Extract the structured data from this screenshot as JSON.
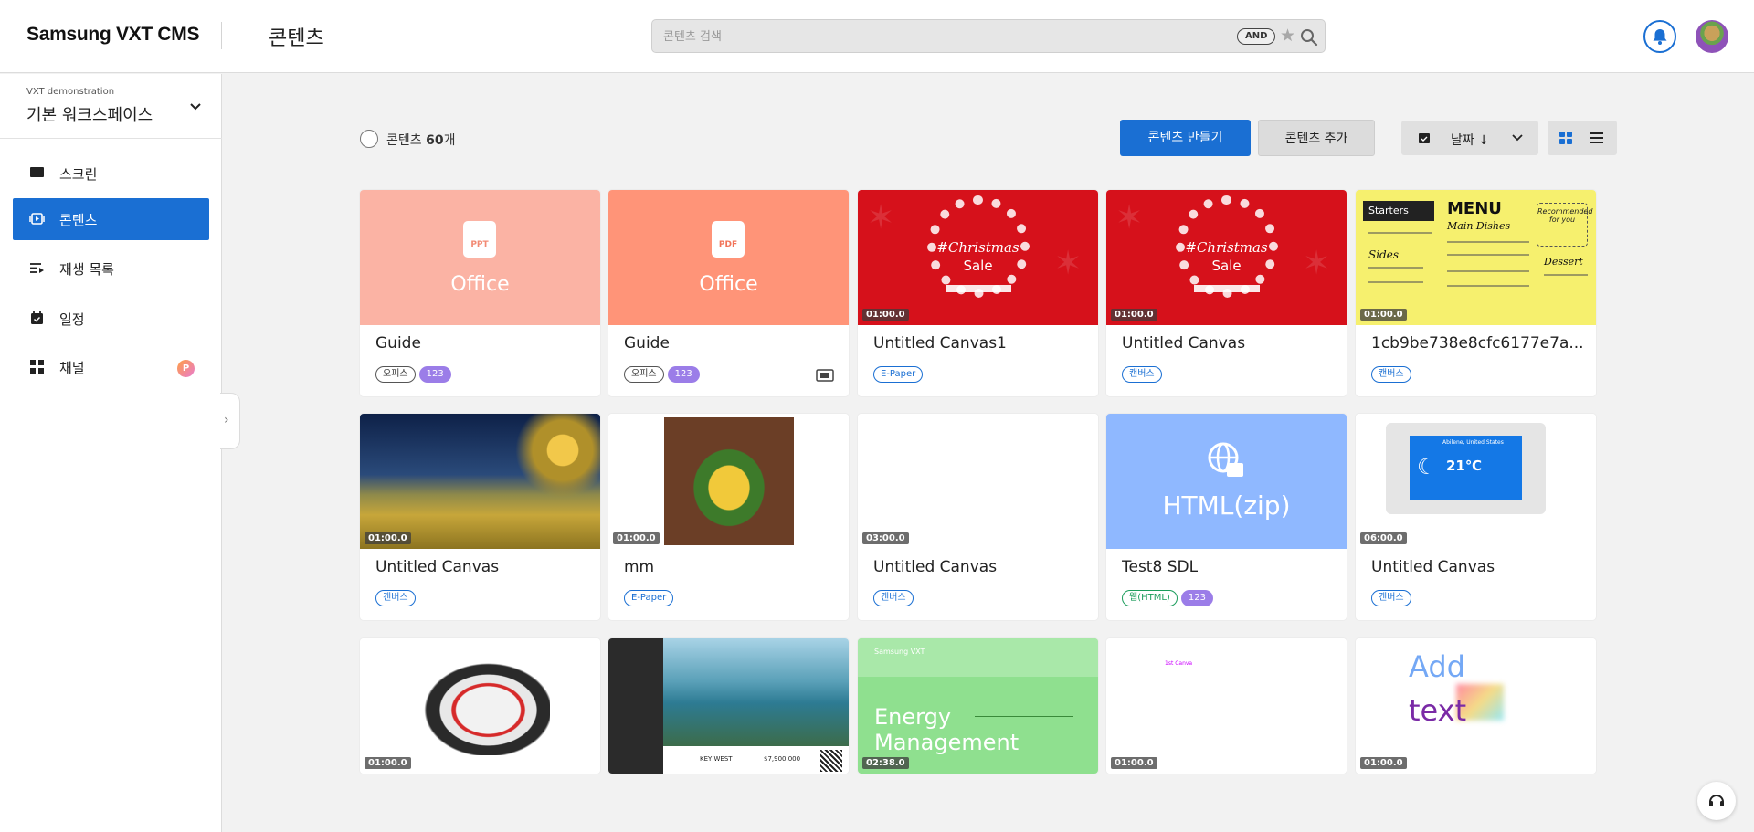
{
  "header": {
    "brand": "Samsung VXT CMS",
    "title": "콘텐츠",
    "search": {
      "placeholder": "콘텐츠 검색",
      "value": "",
      "operator": "AND"
    },
    "icons": [
      "bell-icon",
      "avatar"
    ]
  },
  "sidebar": {
    "workspace_org": "VXT demonstration",
    "workspace_name": "기본 워크스페이스",
    "items": [
      {
        "label": "스크린",
        "icon": "screen-icon"
      },
      {
        "label": "콘텐츠",
        "icon": "content-icon",
        "active": true
      },
      {
        "label": "재생 목록",
        "icon": "playlist-icon"
      },
      {
        "label": "일정",
        "icon": "calendar-icon"
      },
      {
        "label": "채널",
        "icon": "channel-icon",
        "badge": "P"
      }
    ]
  },
  "toolbar": {
    "count_label": "콘텐츠",
    "count_value": "60",
    "count_suffix": "개",
    "create_label": "콘텐츠 만들기",
    "add_label": "콘텐츠 추가",
    "sort_label": "날짜 ↓",
    "view_mode": "grid"
  },
  "colors": {
    "accent": "#1a6fd3",
    "office_ppt": "#fbb3a4",
    "office_pdf": "#ff9478",
    "xmas_red": "#d6111b",
    "html_blue": "#8fb8ff",
    "energy_green": "#8fe08f"
  },
  "cards": [
    {
      "title": "Guide",
      "thumb_label": "Office",
      "file_icon": "PPT",
      "tags": [
        "오피스",
        "123"
      ]
    },
    {
      "title": "Guide",
      "thumb_label": "Office",
      "file_icon": "PDF",
      "tags": [
        "오피스",
        "123"
      ]
    },
    {
      "title": "Untitled Canvas1",
      "duration": "01:00.0",
      "thumb_text1": "#Christmas",
      "thumb_text2": "Sale",
      "tags": [
        "E-Paper"
      ]
    },
    {
      "title": "Untitled Canvas",
      "duration": "01:00.0",
      "thumb_text1": "#Christmas",
      "thumb_text2": "Sale",
      "tags": [
        "캔버스"
      ]
    },
    {
      "title": "1cb9be738e8cfc6177e7a...",
      "duration": "01:00.0",
      "thumb_menu": {
        "starters": "Starters",
        "title": "MENU",
        "main": "Main Dishes",
        "sides": "Sides",
        "dessert": "Dessert",
        "rec": "Recommended for you"
      },
      "tags": [
        "캔버스"
      ]
    },
    {
      "title": "Untitled Canvas",
      "duration": "01:00.0",
      "tags": [
        "캔버스"
      ]
    },
    {
      "title": "mm",
      "duration": "01:00.0",
      "tags": [
        "E-Paper"
      ]
    },
    {
      "title": "Untitled Canvas",
      "duration": "03:00.0",
      "tags": [
        "캔버스"
      ]
    },
    {
      "title": "Test8 SDL",
      "thumb_label": "HTML(zip)",
      "tags": [
        "웹(HTML)",
        "123"
      ]
    },
    {
      "title": "Untitled Canvas",
      "duration": "06:00.0",
      "thumb_weather": {
        "city": "Abilene, United States",
        "temp": "21℃"
      },
      "tags": [
        "캔버스"
      ]
    },
    {
      "duration": "01:00.0"
    },
    {
      "thumb_villa": {
        "label": "KEY WEST",
        "price": "$7,900,000"
      }
    },
    {
      "duration": "02:38.0",
      "thumb_brand": "Samsung VXT",
      "thumb_text1": "Energy",
      "thumb_text2": "Management"
    },
    {
      "duration": "01:00.0",
      "thumb_tiny": "1st Canva"
    },
    {
      "duration": "01:00.0",
      "thumb_text1": "Add",
      "thumb_text2": "text"
    }
  ]
}
